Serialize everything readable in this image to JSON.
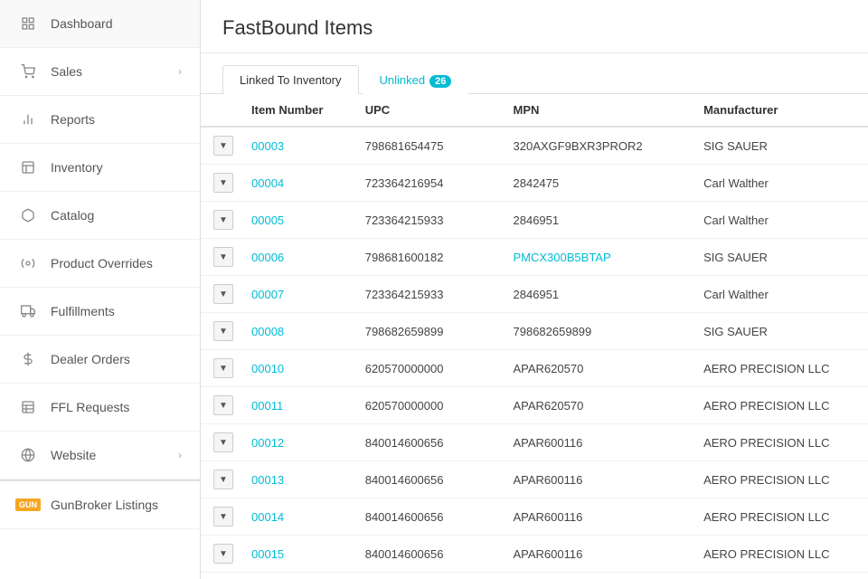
{
  "sidebar": {
    "items": [
      {
        "id": "dashboard",
        "label": "Dashboard",
        "icon": "🏠",
        "arrow": false
      },
      {
        "id": "sales",
        "label": "Sales",
        "icon": "🛒",
        "arrow": true
      },
      {
        "id": "reports",
        "label": "Reports",
        "icon": "📊",
        "arrow": false
      },
      {
        "id": "inventory",
        "label": "Inventory",
        "icon": "📋",
        "arrow": false
      },
      {
        "id": "catalog",
        "label": "Catalog",
        "icon": "📦",
        "arrow": false
      },
      {
        "id": "product-overrides",
        "label": "Product Overrides",
        "icon": "🔧",
        "arrow": false
      },
      {
        "id": "fulfillments",
        "label": "Fulfillments",
        "icon": "🚚",
        "arrow": false
      },
      {
        "id": "dealer-orders",
        "label": "Dealer Orders",
        "icon": "$",
        "arrow": false
      },
      {
        "id": "ffl-requests",
        "label": "FFL Requests",
        "icon": "📋",
        "arrow": false
      },
      {
        "id": "website",
        "label": "Website",
        "icon": "🌐",
        "arrow": true
      },
      {
        "id": "gunbroker-listings",
        "label": "GunBroker Listings",
        "icon": "GUN",
        "arrow": false
      }
    ]
  },
  "main": {
    "title": "FastBound Items",
    "tabs": [
      {
        "id": "linked",
        "label": "Linked To Inventory",
        "active": true,
        "badge": null
      },
      {
        "id": "unlinked",
        "label": "Unlinked",
        "active": false,
        "badge": "26"
      }
    ],
    "table": {
      "columns": [
        "",
        "Item Number",
        "UPC",
        "MPN",
        "Manufacturer"
      ],
      "rows": [
        {
          "item": "00003",
          "upc": "798681654475",
          "mpn": "320AXGF9BXR3PROR2",
          "manufacturer": "SIG SAUER",
          "mpn_linked": false
        },
        {
          "item": "00004",
          "upc": "723364216954",
          "mpn": "2842475",
          "manufacturer": "Carl Walther",
          "mpn_linked": false
        },
        {
          "item": "00005",
          "upc": "723364215933",
          "mpn": "2846951",
          "manufacturer": "Carl Walther",
          "mpn_linked": false
        },
        {
          "item": "00006",
          "upc": "798681600182",
          "mpn": "PMCX300B5BTAP",
          "manufacturer": "SIG SAUER",
          "mpn_linked": true
        },
        {
          "item": "00007",
          "upc": "723364215933",
          "mpn": "2846951",
          "manufacturer": "Carl Walther",
          "mpn_linked": false
        },
        {
          "item": "00008",
          "upc": "798682659899",
          "mpn": "798682659899",
          "manufacturer": "SIG SAUER",
          "mpn_linked": false
        },
        {
          "item": "00010",
          "upc": "620570000000",
          "mpn": "APAR620570",
          "manufacturer": "AERO PRECISION LLC",
          "mpn_linked": false
        },
        {
          "item": "00011",
          "upc": "620570000000",
          "mpn": "APAR620570",
          "manufacturer": "AERO PRECISION LLC",
          "mpn_linked": false
        },
        {
          "item": "00012",
          "upc": "840014600656",
          "mpn": "APAR600116",
          "manufacturer": "AERO PRECISION LLC",
          "mpn_linked": false
        },
        {
          "item": "00013",
          "upc": "840014600656",
          "mpn": "APAR600116",
          "manufacturer": "AERO PRECISION LLC",
          "mpn_linked": false
        },
        {
          "item": "00014",
          "upc": "840014600656",
          "mpn": "APAR600116",
          "manufacturer": "AERO PRECISION LLC",
          "mpn_linked": false
        },
        {
          "item": "00015",
          "upc": "840014600656",
          "mpn": "APAR600116",
          "manufacturer": "AERO PRECISION LLC",
          "mpn_linked": false
        }
      ]
    }
  }
}
